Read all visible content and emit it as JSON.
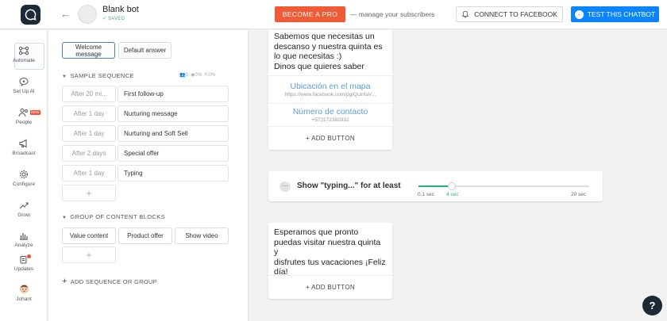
{
  "header": {
    "bot_name": "Blank bot",
    "bot_status": "SAVED",
    "pro_button": "BECOME A PRO",
    "manage_text": "— manage your subscribers",
    "facebook_button": "CONNECT TO FACEBOOK",
    "test_button": "TEST THIS CHATBOT",
    "accent_color": "#0a84ff",
    "pro_color": "#f05b35"
  },
  "nav": {
    "items": [
      {
        "label": "Automate",
        "icon": "automate-icon",
        "active": true
      },
      {
        "label": "Set Up AI",
        "icon": "ai-brain-icon"
      },
      {
        "label": "People",
        "icon": "people-icon",
        "badge": "NEW"
      },
      {
        "label": "Broadcast",
        "icon": "megaphone-icon"
      },
      {
        "label": "Configure",
        "icon": "gear-icon"
      },
      {
        "label": "Grow",
        "icon": "grow-chart-icon"
      },
      {
        "label": "Analyze",
        "icon": "bar-chart-icon"
      },
      {
        "label": "Updates",
        "icon": "updates-icon"
      },
      {
        "label": "Johant",
        "icon": "user-avatar"
      }
    ]
  },
  "panel": {
    "welcome_tab": "Welcome message",
    "default_tab": "Default answer",
    "sequence_title": "SAMPLE SEQUENCE",
    "stats": [
      "0",
      "0%",
      "0%"
    ],
    "sequence": [
      {
        "delay": "After 20 mi...",
        "name": "First follow-up"
      },
      {
        "delay": "After 1 day",
        "name": "Nurturing message"
      },
      {
        "delay": "After 1 day",
        "name": "Nurturing and Soft Sell"
      },
      {
        "delay": "After 2 days",
        "name": "Special offer"
      },
      {
        "delay": "After 1 day",
        "name": "Typing"
      }
    ],
    "plus": "+",
    "group_title": "GROUP OF CONTENT BLOCKS",
    "group_blocks": [
      "Value content",
      "Product offer",
      "Show video"
    ],
    "add_seq": "ADD SEQUENCE OR GROUP"
  },
  "canvas": {
    "card1": {
      "text_lines": [
        "Sabemos que necesitas un",
        "descanso y nuestra quinta es",
        "lo que necesitas :)",
        "Dinos que quieres saber"
      ],
      "buttons": [
        {
          "title": "Ubicación en el mapa",
          "sub": "https://www.facebook.com/pg/QuintaV..."
        },
        {
          "title": "Número de contacto",
          "sub": "+573172382932"
        }
      ],
      "add_button": "+ ADD BUTTON"
    },
    "typing": {
      "label": "Show \"typing...\" for at least",
      "min": "0.1 sec",
      "value_label": "4 sec",
      "max": "20 sec",
      "value_seconds": 4,
      "min_seconds": 0.1,
      "max_seconds": 20
    },
    "card2": {
      "text_lines": [
        "Esperamos que pronto",
        "puedas visitar nuestra quinta y",
        "disfrutes tus vacaciones ¡Feliz",
        "día!"
      ],
      "add_button": "+ ADD BUTTON"
    },
    "help": "?"
  }
}
